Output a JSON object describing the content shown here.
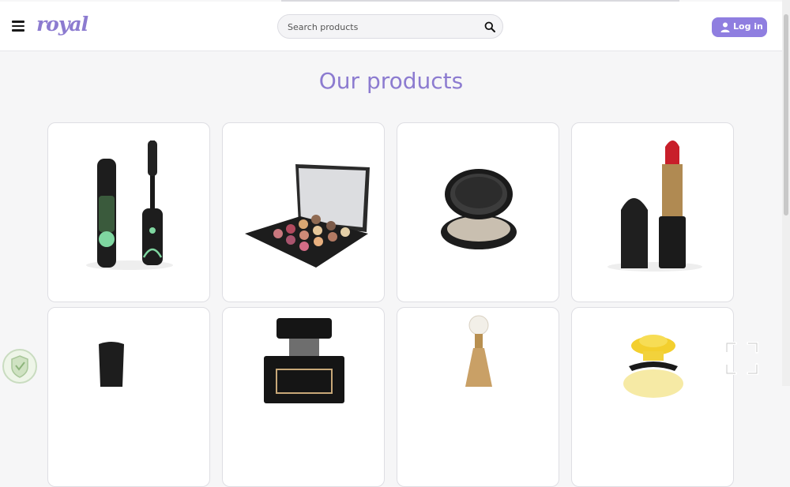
{
  "header": {
    "logo": "royal",
    "search_placeholder": "Search products",
    "login_label": "Log in"
  },
  "main": {
    "title": "Our products",
    "products": [
      {
        "name": "mascara"
      },
      {
        "name": "eyeshadow-palette"
      },
      {
        "name": "compact-powder"
      },
      {
        "name": "lipstick"
      },
      {
        "name": "nail-polish"
      },
      {
        "name": "perfume-bottle"
      },
      {
        "name": "gold-perfume"
      },
      {
        "name": "floral-perfume"
      }
    ]
  },
  "colors": {
    "brand": "#8c7bd0",
    "button": "#8f7ee0",
    "background": "#f6f6f7"
  },
  "icons": [
    "menu-icon",
    "search-icon",
    "user-icon",
    "fullscreen-icon",
    "shield-icon"
  ]
}
